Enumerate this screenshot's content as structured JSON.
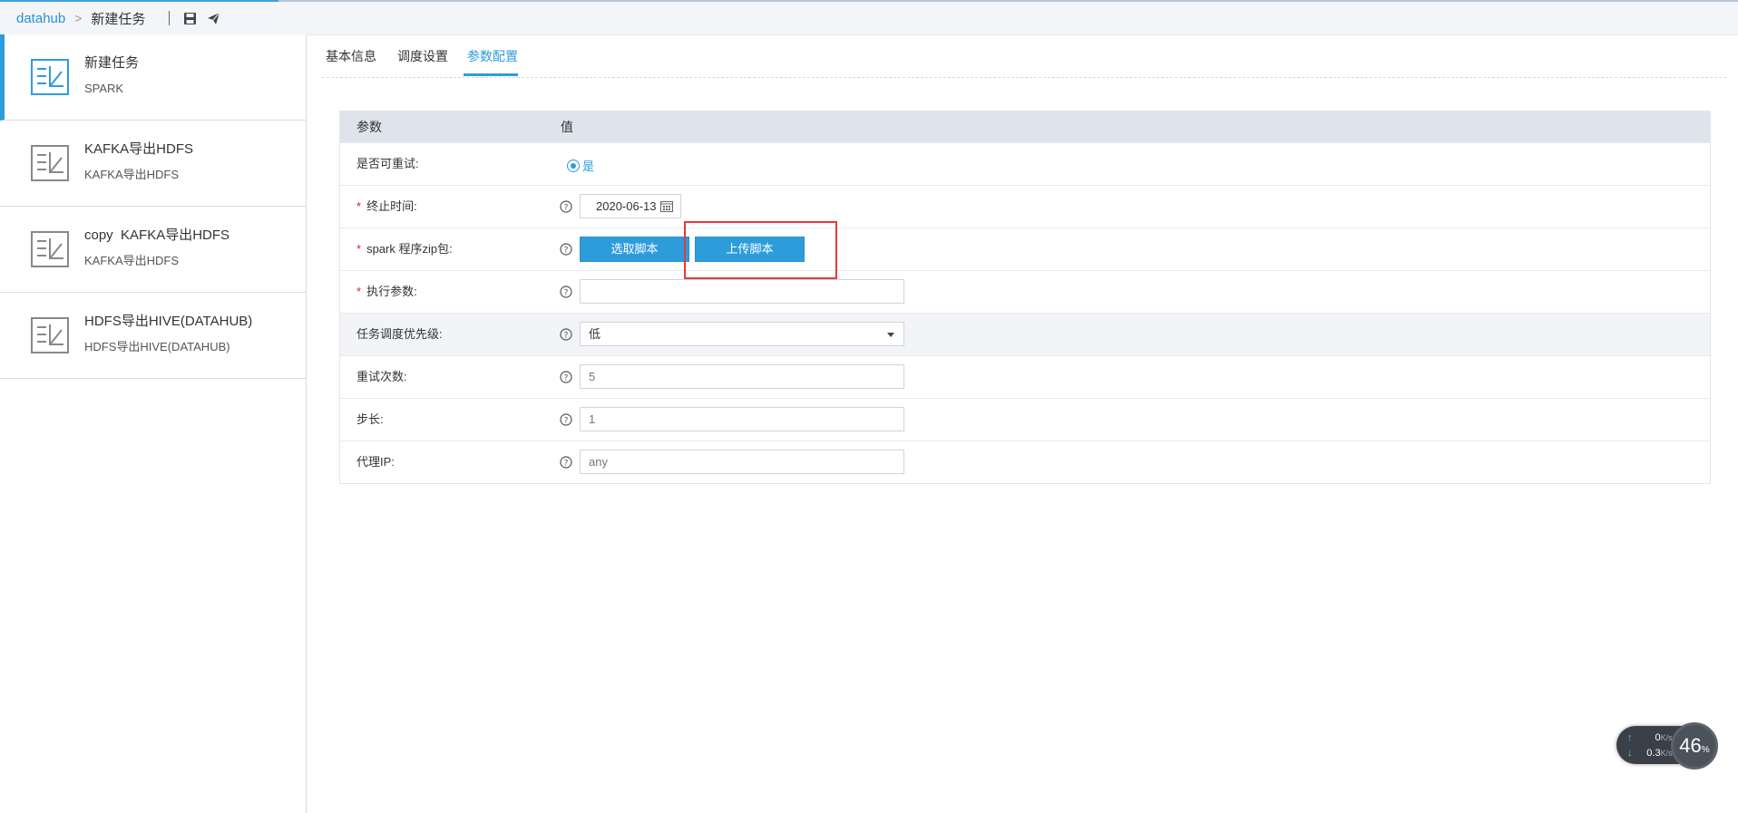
{
  "header": {
    "breadcrumb_root": "datahub",
    "breadcrumb_sep": ">",
    "breadcrumb_current": "新建任务",
    "icons": [
      "save-icon",
      "send-icon"
    ]
  },
  "sidebar": {
    "items": [
      {
        "title": "新建任务",
        "subtitle": "SPARK",
        "active": true
      },
      {
        "title": "KAFKA导出HDFS",
        "subtitle": "KAFKA导出HDFS"
      },
      {
        "title": "copy  KAFKA导出HDFS",
        "subtitle": "KAFKA导出HDFS"
      },
      {
        "title": "HDFS导出HIVE(DATAHUB)",
        "subtitle": "HDFS导出HIVE(DATAHUB)"
      }
    ]
  },
  "tabs": [
    {
      "label": "基本信息"
    },
    {
      "label": "调度设置"
    },
    {
      "label": "参数配置",
      "active": true
    }
  ],
  "table": {
    "head_param": "参数",
    "head_value": "值",
    "required_mark": "*",
    "rows": {
      "retry": {
        "label": "是否可重试:",
        "option": "是"
      },
      "end_time": {
        "label": "终止时间:",
        "value": "2020-06-13"
      },
      "spark_zip": {
        "label": "spark 程序zip包:",
        "select_btn": "选取脚本",
        "upload_btn": "上传脚本"
      },
      "exec_params": {
        "label": "执行参数:",
        "value": ""
      },
      "priority": {
        "label": "任务调度优先级:",
        "value": "低"
      },
      "retry_count": {
        "label": "重试次数:",
        "value": "5"
      },
      "step": {
        "label": "步长:",
        "value": "1"
      },
      "proxy_ip": {
        "label": "代理IP:",
        "value": "any"
      }
    }
  },
  "speed_widget": {
    "up": "0",
    "down": "0.3",
    "unit": "K/s",
    "percent": "46",
    "percent_sign": "%"
  },
  "colors": {
    "accent": "#2d9cdb",
    "highlight": "#e53a3a",
    "required": "#e02020"
  }
}
